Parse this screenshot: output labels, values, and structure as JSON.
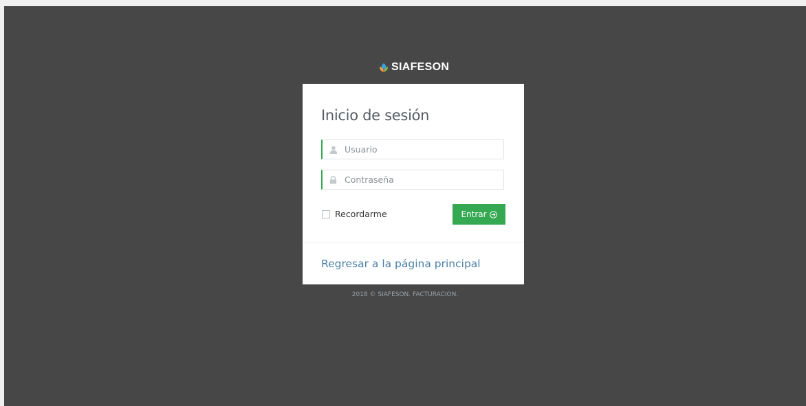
{
  "brand": {
    "name": "SIAFESON"
  },
  "login": {
    "title": "Inicio de sesión",
    "username_placeholder": "Usuario",
    "password_placeholder": "Contraseña",
    "remember_label": "Recordarme",
    "submit_label": "Entrar",
    "back_link": "Regresar a la página principal"
  },
  "footer": {
    "text": "2018 © SIAFESON. FACTURACION."
  },
  "icons": {
    "logo": "leaf-logo-icon",
    "username": "user-icon",
    "password": "lock-icon",
    "submit": "circle-arrow-right-icon"
  },
  "colors": {
    "background": "#474747",
    "accent": "#35a852",
    "link": "#4a7fa5"
  }
}
